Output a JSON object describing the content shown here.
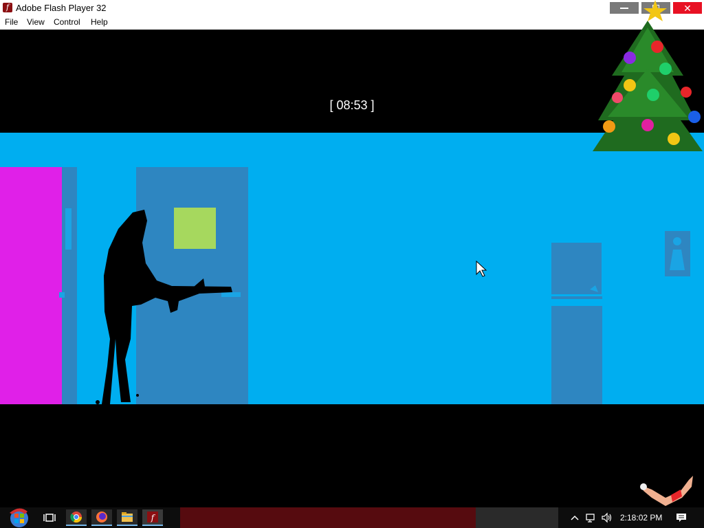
{
  "window": {
    "title": "Adobe Flash Player 32",
    "app_icon_glyph": "f"
  },
  "menu": {
    "items": [
      "File",
      "View",
      "Control",
      "Help"
    ]
  },
  "game": {
    "timer_text": "[ 08:53 ]"
  },
  "taskbar": {
    "clock": "2:18:02 PM",
    "pinned": [
      {
        "name": "task-view-icon"
      },
      {
        "name": "chrome-icon"
      },
      {
        "name": "firefox-icon"
      },
      {
        "name": "file-explorer-icon"
      },
      {
        "name": "flash-player-icon"
      }
    ]
  },
  "colors": {
    "sky": "#00aef0",
    "door": "#2e86c1",
    "magenta_door": "#e020e8",
    "green_window": "#a6d85e",
    "close_red": "#e81123"
  }
}
